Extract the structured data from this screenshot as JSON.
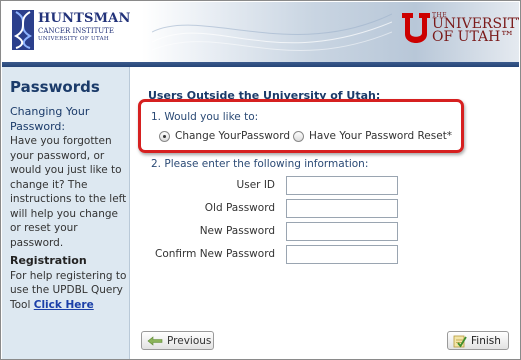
{
  "header": {
    "hci_name": "HUNTSMAN",
    "hci_sub": "CANCER INSTITUTE",
    "hci_sub2": "UNIVERSITY OF UTAH",
    "uofu_the": "THE",
    "uofu_name_line1": "UNIVERSITY",
    "uofu_name_line2": "OF UTAH™"
  },
  "sidebar": {
    "title": "Passwords",
    "changing_heading": "Changing Your Password:",
    "changing_text": "Have you forgotten your password, or would you just like to change it? The instructions to the left will help you change or reset your password.",
    "registration_heading": "Registration",
    "registration_text": "For help registering to use the UPDBL Query Tool",
    "registration_link": "Click Here"
  },
  "main": {
    "title": "Users Outside the University of Utah:",
    "question1": "1. Would you like to:",
    "options": [
      {
        "label": "Change YourPassword",
        "checked": true
      },
      {
        "label": "Have Your Password Reset*",
        "checked": false
      }
    ],
    "question2": "2. Please enter the following information:",
    "fields": [
      {
        "label": "User ID",
        "value": ""
      },
      {
        "label": "Old Password",
        "value": ""
      },
      {
        "label": "New Password",
        "value": ""
      },
      {
        "label": "Confirm New Password",
        "value": ""
      }
    ]
  },
  "buttons": {
    "previous": "Previous",
    "finish": "Finish"
  },
  "colors": {
    "accent_red": "#d62020",
    "nav_blue": "#1b3b6a",
    "sidebar_bg": "#dde8f1"
  }
}
